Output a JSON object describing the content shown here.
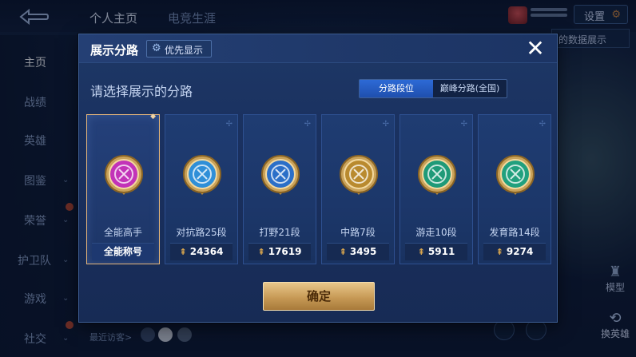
{
  "topbar": {
    "tabs": [
      "个人主页",
      "电竞生涯"
    ],
    "settings_label": "设置",
    "data_show_label": "的数据展示"
  },
  "sidebar": {
    "items": [
      "主页",
      "战绩",
      "英雄",
      "图鉴",
      "荣誉",
      "护卫队",
      "游戏",
      "社交"
    ]
  },
  "footer": {
    "recent_visitors": "最近访客>",
    "model_label": "模型",
    "swap_hero_label": "换英雄"
  },
  "modal": {
    "title": "展示分路",
    "priority_label": "优先显示",
    "subtitle": "请选择展示的分路",
    "segments": [
      "分路段位",
      "巅峰分路(全国)"
    ],
    "confirm_label": "确定",
    "close_symbol": "✕"
  },
  "cards": [
    {
      "label": "全能高手",
      "value": "全能称号",
      "icon": "all-round-emblem-icon",
      "color": "#c233b8",
      "selected": true
    },
    {
      "label": "对抗路25段",
      "value": "24364",
      "icon": "clash-lane-emblem-icon",
      "color": "#2f8fd8",
      "selected": false
    },
    {
      "label": "打野21段",
      "value": "17619",
      "icon": "jungle-emblem-icon",
      "color": "#2b6fc8",
      "selected": false
    },
    {
      "label": "中路7段",
      "value": "3495",
      "icon": "mid-lane-emblem-icon",
      "color": "#b98a2f",
      "selected": false
    },
    {
      "label": "游走10段",
      "value": "5911",
      "icon": "roam-emblem-icon",
      "color": "#1f9a78",
      "selected": false
    },
    {
      "label": "发育路14段",
      "value": "9274",
      "icon": "farm-lane-emblem-icon",
      "color": "#21a07e",
      "selected": false
    }
  ],
  "colors": {
    "accent_gold": "#e7b77a",
    "segment_active": "#2d6ad6",
    "confirm_button": "#c79a56"
  }
}
